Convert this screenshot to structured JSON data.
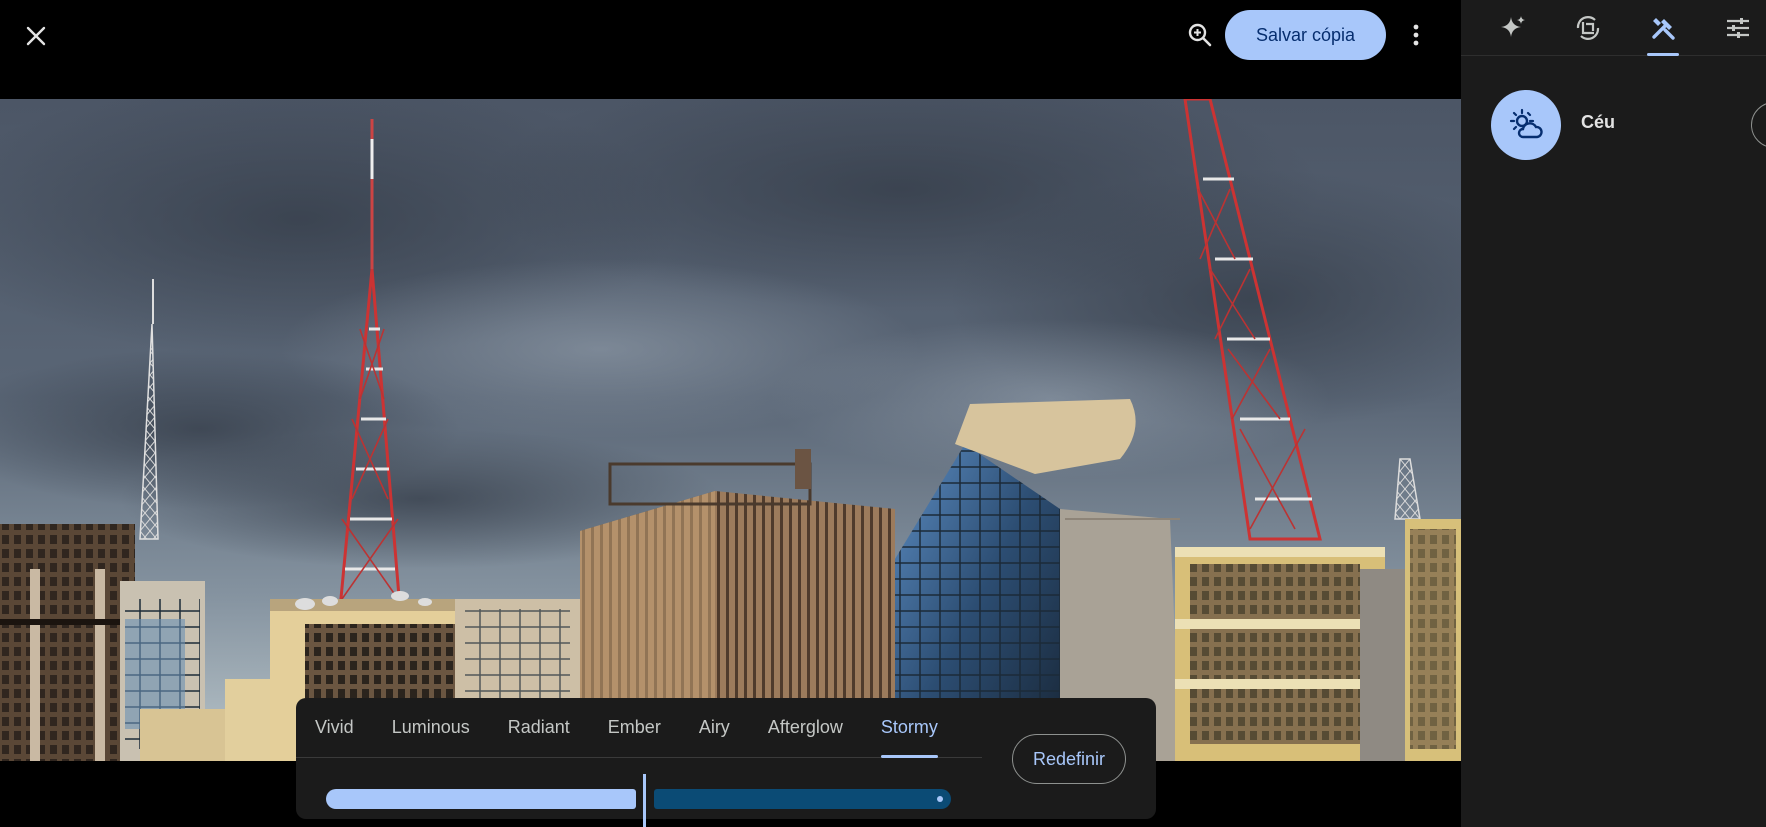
{
  "toolbar": {
    "close_icon": "close-icon",
    "zoom_icon": "zoom-in-icon",
    "save_label": "Salvar cópia",
    "more_icon": "more-vert-icon"
  },
  "sidebar": {
    "tabs": [
      {
        "icon": "sparkle-icon",
        "active": false
      },
      {
        "icon": "crop-rotate-icon",
        "active": false
      },
      {
        "icon": "tools-icon",
        "active": true
      },
      {
        "icon": "sliders-icon",
        "active": false
      }
    ],
    "tool_label": "Céu",
    "tool_icon": "sky-icon"
  },
  "filters": {
    "tabs": [
      {
        "label": "Vivid"
      },
      {
        "label": "Luminous"
      },
      {
        "label": "Radiant"
      },
      {
        "label": "Ember"
      },
      {
        "label": "Airy"
      },
      {
        "label": "Afterglow"
      },
      {
        "label": "Stormy"
      }
    ],
    "active": "Stormy",
    "reset_label": "Redefinir",
    "slider_level": 0.52
  },
  "colors": {
    "accent": "#a8c7fa",
    "accent_dark": "#0b4b75",
    "panel": "#1b1b1b",
    "save_text": "#062e6f"
  }
}
